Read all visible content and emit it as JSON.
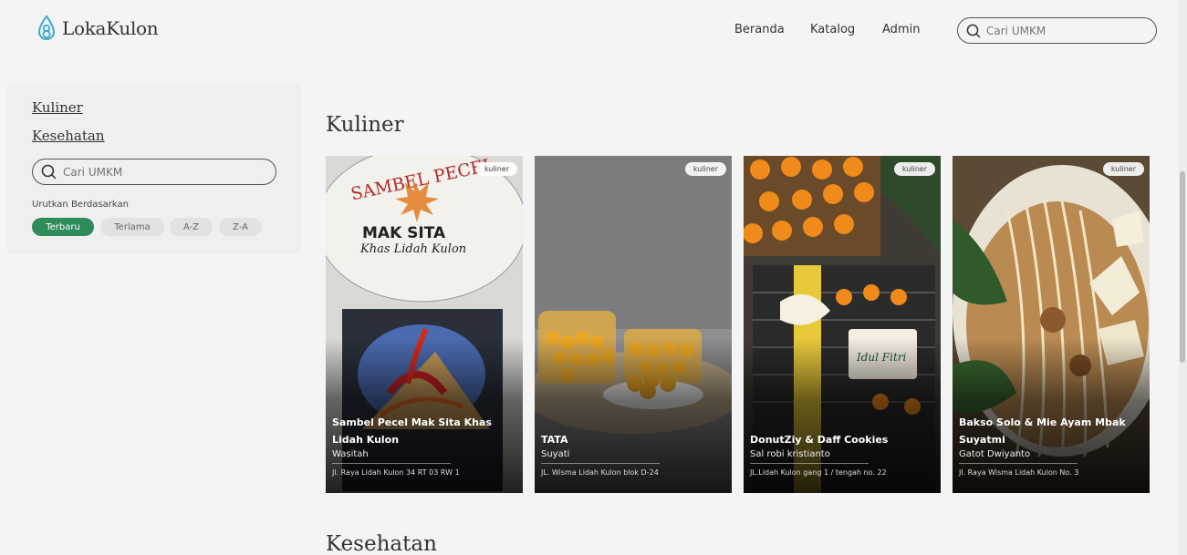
{
  "header": {
    "brand": "LokaKulon",
    "nav": [
      "Beranda",
      "Katalog",
      "Admin"
    ],
    "search_placeholder": "Cari UMKM"
  },
  "sidebar": {
    "categories": [
      "Kuliner",
      "Kesehatan"
    ],
    "search_placeholder": "Cari UMKM",
    "sort_label": "Urutkan Berdasarkan",
    "sort_options": [
      "Terbaru",
      "Terlama",
      "A-Z",
      "Z-A"
    ],
    "active_sort": "Terbaru"
  },
  "sections": [
    {
      "title": "Kuliner",
      "cards": [
        {
          "tag": "kuliner",
          "title": "Sambel Pecel Mak Sita Khas Lidah Kulon",
          "owner": "Wasitah",
          "address": "Jl. Raya Lidah Kulon 34 RT 03 RW 1"
        },
        {
          "tag": "kuliner",
          "title": "TATA",
          "owner": "Suyati",
          "address": "JL. Wisma Lidah Kulon blok D-24"
        },
        {
          "tag": "kuliner",
          "title": "DonutZiy & Daff Cookies",
          "owner": "Sal robi kristianto",
          "address": "JL.Lidah Kulon gang 1 / tengah no. 22"
        },
        {
          "tag": "kuliner",
          "title": "Bakso Solo & Mie Ayam Mbak Suyatmi",
          "owner": "Gatot Dwiyanto",
          "address": "Jl. Raya Wisma Lidah Kulon No. 3"
        }
      ]
    },
    {
      "title": "Kesehatan",
      "cards": []
    }
  ],
  "colors": {
    "accent": "#2e8b5a",
    "background": "#f4f4f4",
    "logo": "#3fa9c9"
  },
  "icons": {
    "logo": "droplet-logo-icon",
    "search": "search-icon"
  }
}
